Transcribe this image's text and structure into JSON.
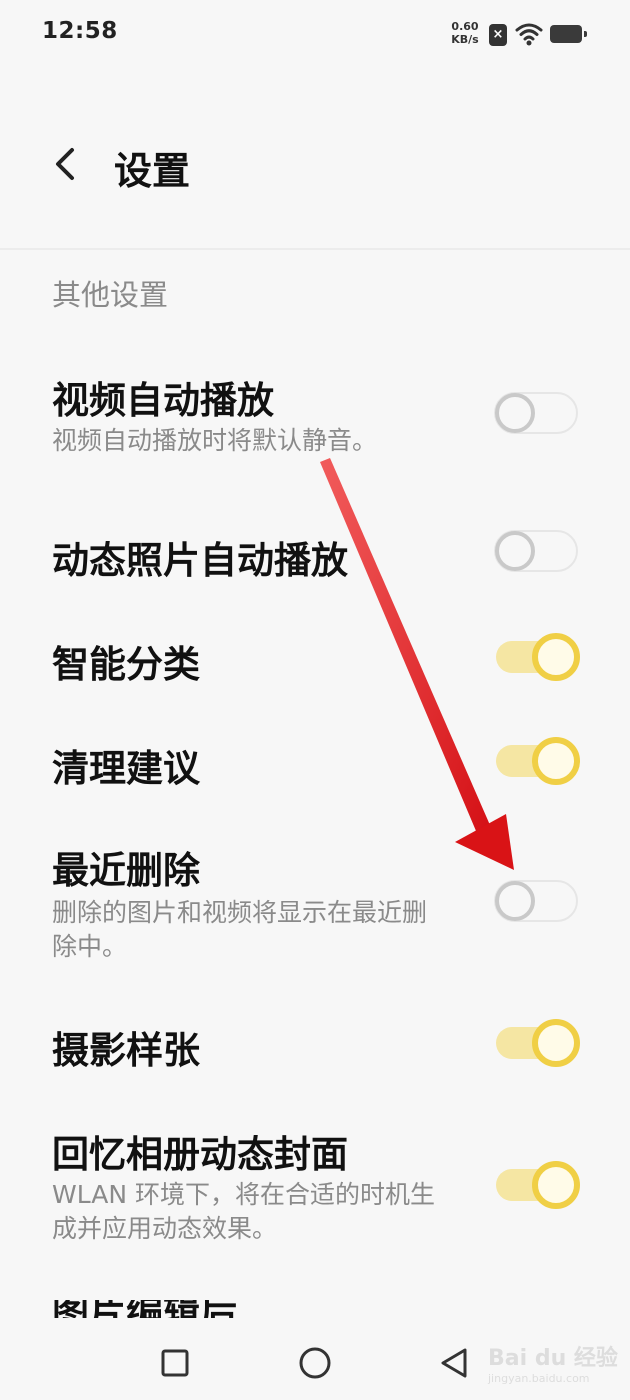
{
  "status_bar": {
    "time": "12:58",
    "net_speed_value": "0.60",
    "net_speed_unit": "KB/s",
    "notification_symbol": "×",
    "icons": [
      "close-notification-icon",
      "wifi-icon",
      "battery-icon"
    ]
  },
  "header": {
    "title": "设置",
    "back_icon": "chevron-left-icon"
  },
  "section": {
    "title": "其他设置"
  },
  "settings": [
    {
      "title": "视频自动播放",
      "desc": "视频自动播放时将默认静音。",
      "enabled": false
    },
    {
      "title": "动态照片自动播放",
      "desc": "",
      "enabled": false
    },
    {
      "title": "智能分类",
      "desc": "",
      "enabled": true
    },
    {
      "title": "清理建议",
      "desc": "",
      "enabled": true
    },
    {
      "title": "最近删除",
      "desc": "删除的图片和视频将显示在最近删除中。",
      "enabled": false
    },
    {
      "title": "摄影样张",
      "desc": "",
      "enabled": true
    },
    {
      "title": "回忆相册动态封面",
      "desc": "WLAN 环境下，将在合适的时机生成并应用动态效果。",
      "enabled": true
    }
  ],
  "partial_item": {
    "title": "图片编辑后"
  },
  "nav_bar": {
    "buttons": [
      "recents-square-icon",
      "home-circle-icon",
      "back-triangle-icon"
    ]
  },
  "watermark": {
    "text": "Bai du 经验",
    "url": "jingyan.baidu.com"
  },
  "colors": {
    "toggle_on_thumb": "#f0cf45",
    "toggle_on_track": "#f5e6a3",
    "toggle_off": "#c9c9c9",
    "annotation_arrow": "#e3191c"
  }
}
